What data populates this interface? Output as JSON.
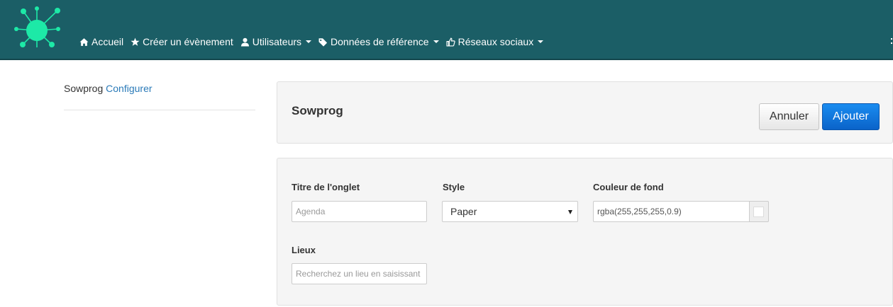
{
  "nav": {
    "items": [
      {
        "label": "Accueil",
        "icon": "home-icon"
      },
      {
        "label": "Créer un évènement",
        "icon": "star-icon"
      },
      {
        "label": "Utilisateurs",
        "icon": "user-icon"
      },
      {
        "label": "Données de référence",
        "icon": "tag-icon"
      },
      {
        "label": "Réseaux sociaux",
        "icon": "thumbs-up-icon"
      }
    ]
  },
  "sidebar": {
    "brand": "Sowprog",
    "link": "Configurer"
  },
  "header": {
    "title": "Sowprog",
    "cancel_label": "Annuler",
    "add_label": "Ajouter"
  },
  "form": {
    "tab_title": {
      "label": "Titre de l'onglet",
      "placeholder": "Agenda"
    },
    "style": {
      "label": "Style",
      "value": "Paper"
    },
    "bg_color": {
      "label": "Couleur de fond",
      "value": "rgba(255,255,255,0.9)"
    },
    "places": {
      "label": "Lieux",
      "placeholder": "Recherchez un lieu en saisissant son nom"
    }
  },
  "colors": {
    "navbar": "#1b5e66",
    "logo": "#1de9a7",
    "primary": "#0a63c9",
    "link": "#2a7ab8"
  }
}
